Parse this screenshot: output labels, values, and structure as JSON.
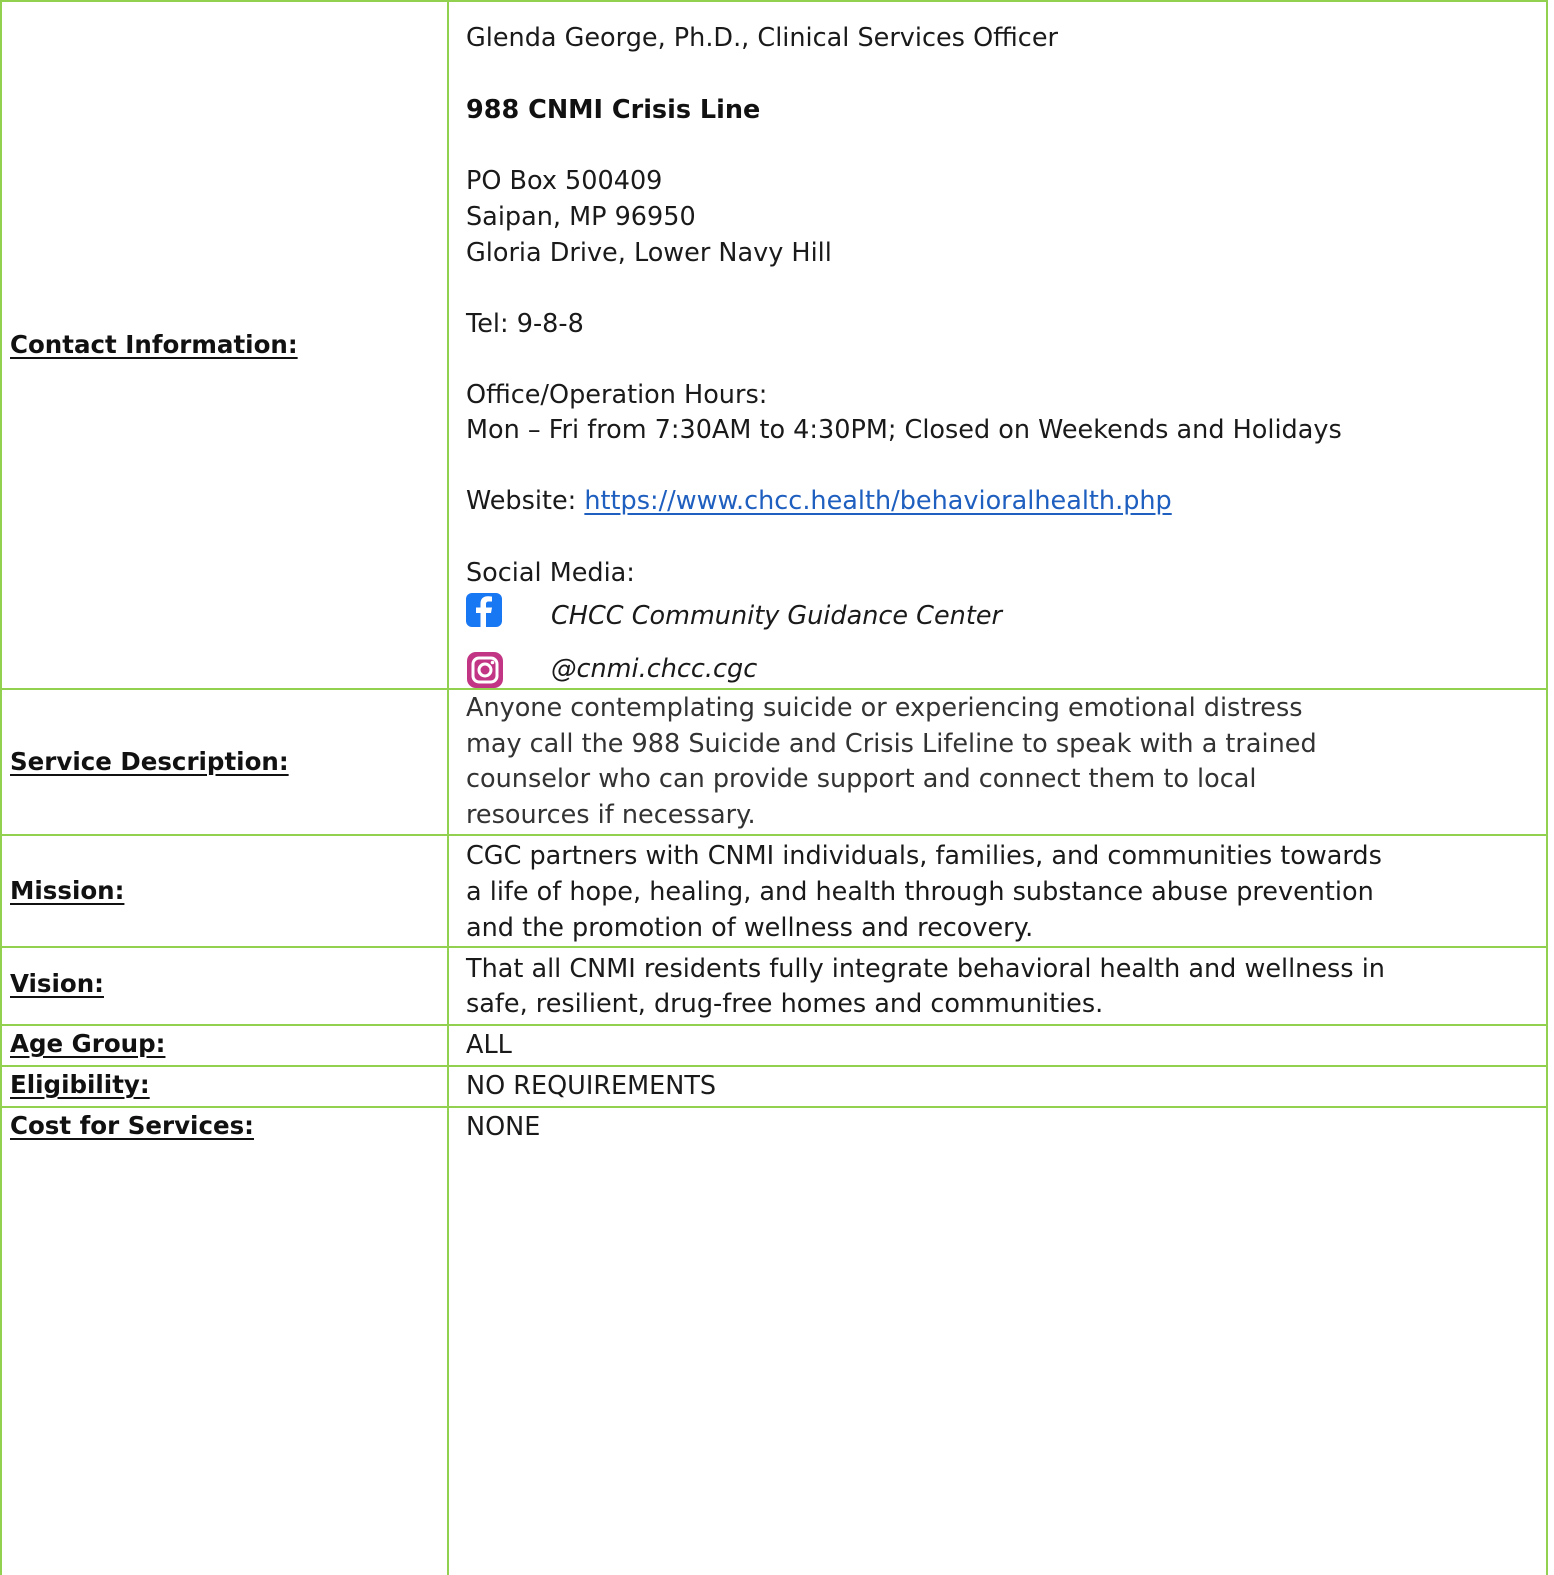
{
  "colors": {
    "border": "#92d050",
    "link": "#1f5fbf",
    "facebook": "#1877f2"
  },
  "rows": {
    "contact": {
      "label": "Contact Information:",
      "officer": "Glenda George, Ph.D., Clinical Services Officer",
      "org_name": "988 CNMI Crisis Line",
      "address_line1": "PO Box 500409",
      "address_line2": "Saipan, MP 96950",
      "address_line3": "Gloria Drive, Lower Navy Hill",
      "tel": "Tel: 9-8-8",
      "hours_label": "Office/Operation Hours:",
      "hours_value": "Mon – Fri from 7:30AM to 4:30PM; Closed on Weekends and Holidays",
      "website_label": "Website: ",
      "website_url": "https://www.chcc.health/behavioralhealth.php",
      "social_label": "Social Media:",
      "facebook_icon": "facebook-icon",
      "facebook_name": "CHCC Community Guidance Center",
      "instagram_icon": "instagram-icon",
      "instagram_handle": "@cnmi.chcc.cgc"
    },
    "service": {
      "label": "Service Description:",
      "lines": [
        "Anyone contemplating suicide or experiencing emotional distress",
        "may call the 988 Suicide and Crisis Lifeline to speak with a trained",
        "counselor who can provide support and connect them to local",
        "resources if necessary."
      ]
    },
    "mission": {
      "label": "Mission:",
      "lines": [
        "CGC partners with CNMI individuals, families, and communities towards",
        "a life of hope, healing, and health through substance abuse prevention",
        "and the promotion of wellness and recovery."
      ]
    },
    "vision": {
      "label": "Vision:",
      "lines": [
        "That all CNMI residents fully integrate behavioral health and wellness in",
        "safe, resilient, drug-free homes and communities."
      ]
    },
    "age": {
      "label": "Age Group:",
      "value": "ALL"
    },
    "eligibility": {
      "label": "Eligibility:",
      "value": "NO REQUIREMENTS"
    },
    "cost": {
      "label": "Cost for Services:",
      "value": "NONE"
    }
  }
}
